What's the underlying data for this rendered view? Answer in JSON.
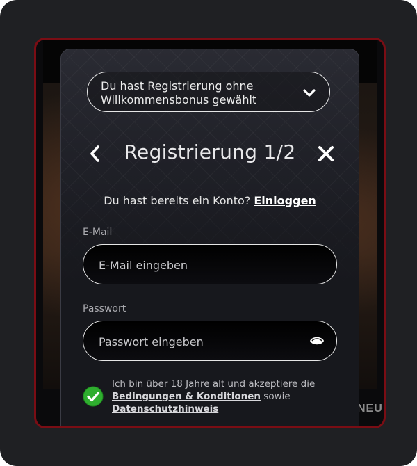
{
  "bonus_select": {
    "text": "Du hast Registrierung ohne Willkommensbonus gewählt"
  },
  "header": {
    "title": "Registrierung 1/2"
  },
  "login": {
    "prompt": "Du hast bereits ein Konto?",
    "link": "Einloggen"
  },
  "email": {
    "label": "E-Mail",
    "placeholder": "E-Mail eingeben",
    "value": ""
  },
  "password": {
    "label": "Passwort",
    "placeholder": "Passwort eingeben",
    "value": ""
  },
  "terms": {
    "checked": true,
    "text_before": "Ich bin über 18 Jahre alt und akzeptiere die",
    "link_terms": "Bedingungen & Konditionen",
    "text_middle": "sowie",
    "link_privacy": "Datenschutzhinweis"
  },
  "background": {
    "partial_text": "NEU"
  },
  "colors": {
    "frame_border": "#7a0d14",
    "check_green": "#2fae2f"
  },
  "icons": {
    "bonus_chevron": "chevron-down-icon",
    "back": "chevron-left-icon",
    "close": "close-icon",
    "password_toggle": "eye-icon",
    "terms_check": "check-circle-icon"
  }
}
